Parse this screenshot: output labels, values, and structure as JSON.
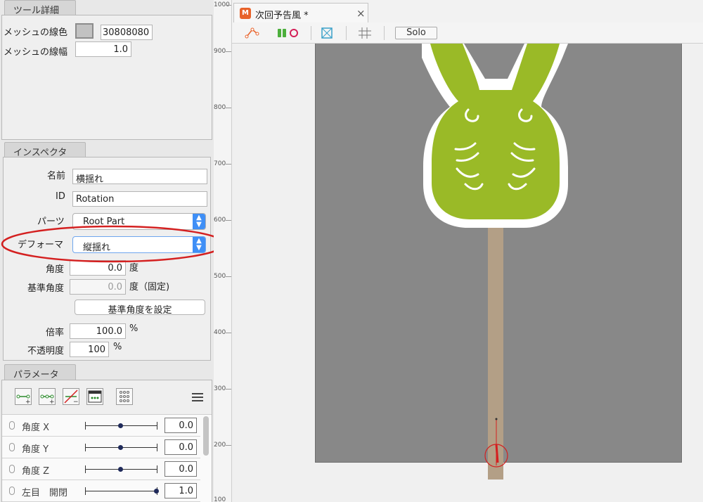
{
  "tool_detail": {
    "tab": "ツール詳細",
    "mesh_color_label": "メッシュの線色",
    "mesh_color_value": "30808080",
    "mesh_width_label": "メッシュの線幅",
    "mesh_width_value": "1.0"
  },
  "inspector": {
    "tab": "インスペクタ",
    "name_label": "名前",
    "name_value": "横揺れ",
    "id_label": "ID",
    "id_value": "Rotation",
    "parts_label": "パーツ",
    "parts_value": "Root Part",
    "deformer_label": "デフォーマ",
    "deformer_value": "縦揺れ",
    "angle_label": "角度",
    "angle_value": "0.0",
    "angle_unit": "度",
    "base_angle_label": "基準角度",
    "base_angle_value": "0.0",
    "base_angle_unit": "度（固定)",
    "set_base_angle_button": "基準角度を設定",
    "scale_label": "倍率",
    "scale_value": "100.0",
    "scale_unit": "%",
    "opacity_label": "不透明度",
    "opacity_value": "100",
    "opacity_unit": "%"
  },
  "parameters": {
    "tab": "パラメータ",
    "rows": [
      {
        "label": "角度 X",
        "value": "0.0",
        "knob": 0.5
      },
      {
        "label": "角度 Y",
        "value": "0.0",
        "knob": 0.5
      },
      {
        "label": "角度 Z",
        "value": "0.0",
        "knob": 0.5
      },
      {
        "label": "左目　開閉",
        "value": "1.0",
        "knob": 1.0
      }
    ]
  },
  "ruler": {
    "ticks": [
      "1000",
      "900",
      "800",
      "700",
      "600",
      "500",
      "400",
      "300",
      "200",
      "100"
    ]
  },
  "document": {
    "tab_title": "次回予告風 *",
    "close_glyph": "×",
    "solo_label": "Solo"
  },
  "colors": {
    "character_green": "#9aba27",
    "stick": "#b39f86",
    "artboard": "#888888",
    "highlight_red": "#d42020",
    "accent_blue": "#3f8ff6"
  }
}
